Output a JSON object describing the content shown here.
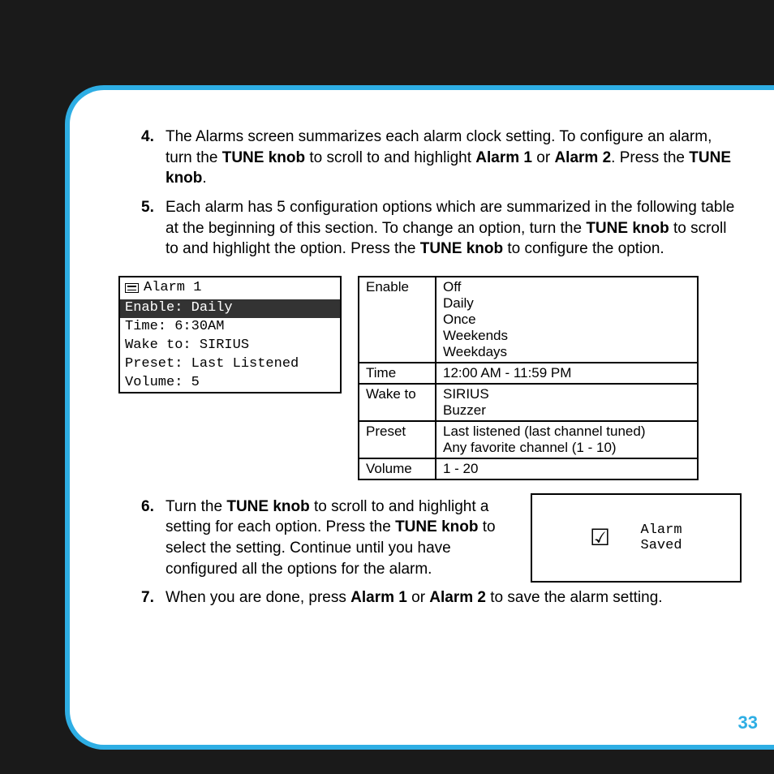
{
  "steps_first": [
    {
      "num": "4.",
      "parts": [
        {
          "t": "The Alarms screen summarizes each alarm clock setting. To configure an alarm, turn the "
        },
        {
          "t": "TUNE knob",
          "b": true
        },
        {
          "t": " to scroll to and highlight "
        },
        {
          "t": "Alarm 1",
          "b": true
        },
        {
          "t": " or "
        },
        {
          "t": "Alarm 2",
          "b": true
        },
        {
          "t": ". Press the "
        },
        {
          "t": "TUNE knob",
          "b": true
        },
        {
          "t": "."
        }
      ]
    },
    {
      "num": "5.",
      "parts": [
        {
          "t": "Each alarm has 5 configuration options which are summarized in the following table at the beginning of this section. To change an option, turn the "
        },
        {
          "t": "TUNE knob",
          "b": true
        },
        {
          "t": " to scroll to and highlight the option. Press the "
        },
        {
          "t": "TUNE knob",
          "b": true
        },
        {
          "t": " to configure the option."
        }
      ]
    }
  ],
  "screen": {
    "title": "Alarm 1",
    "rows": [
      {
        "label": "Enable: Daily",
        "hl": true
      },
      {
        "label": "Time: 6:30AM"
      },
      {
        "label": "Wake to: SIRIUS"
      },
      {
        "label": "Preset: Last Listened"
      },
      {
        "label": "Volume: 5"
      }
    ]
  },
  "options": [
    {
      "name": "Enable",
      "values": [
        "Off",
        "Daily",
        "Once",
        "Weekends",
        "Weekdays"
      ]
    },
    {
      "name": "Time",
      "values": [
        "12:00 AM - 11:59 PM"
      ]
    },
    {
      "name": "Wake to",
      "values": [
        "SIRIUS",
        "Buzzer"
      ]
    },
    {
      "name": "Preset",
      "values": [
        "Last listened (last channel tuned)",
        "Any favorite channel (1 - 10)"
      ]
    },
    {
      "name": "Volume",
      "values": [
        "1 - 20"
      ]
    }
  ],
  "steps_second": [
    {
      "num": "6.",
      "parts": [
        {
          "t": "Turn the "
        },
        {
          "t": "TUNE knob",
          "b": true
        },
        {
          "t": " to scroll to and highlight a setting for each option. Press the "
        },
        {
          "t": "TUNE knob",
          "b": true
        },
        {
          "t": " to select the setting. Continue until you have configured all the options for the alarm."
        }
      ]
    },
    {
      "num": "7.",
      "parts": [
        {
          "t": "When you are done, press "
        },
        {
          "t": "Alarm 1",
          "b": true
        },
        {
          "t": " or "
        },
        {
          "t": "Alarm 2",
          "b": true
        },
        {
          "t": " to save the alarm setting."
        }
      ]
    }
  ],
  "saved": {
    "line1": "Alarm",
    "line2": "Saved"
  },
  "page_number": "33"
}
